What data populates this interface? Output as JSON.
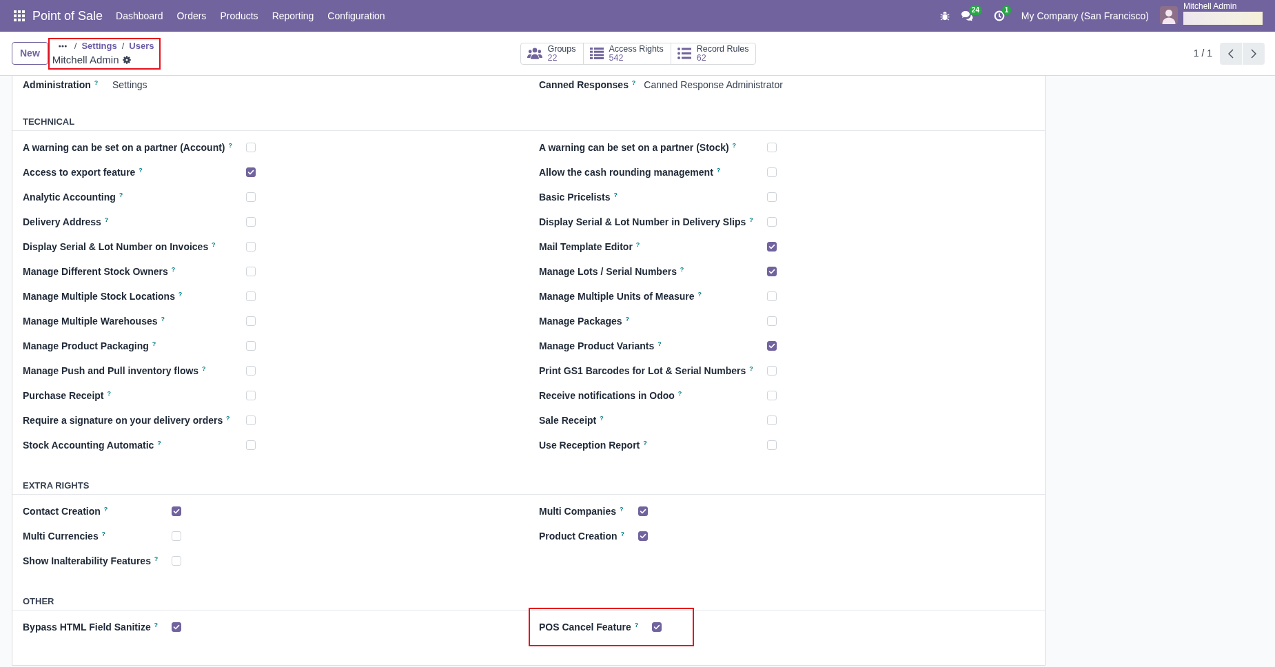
{
  "navbar": {
    "app_name": "Point of Sale",
    "menu": [
      {
        "label": "Dashboard"
      },
      {
        "label": "Orders"
      },
      {
        "label": "Products"
      },
      {
        "label": "Reporting"
      },
      {
        "label": "Configuration"
      }
    ],
    "systray": [
      {
        "kind": "debug"
      },
      {
        "kind": "messages",
        "badge": "24"
      },
      {
        "kind": "activities",
        "badge": "1"
      }
    ],
    "company": "My Company (San Francisco)",
    "user": "Mitchell Admin"
  },
  "control_panel": {
    "new_button": "New",
    "breadcrumb": {
      "links": [
        {
          "separator": "/",
          "label": "Settings"
        },
        {
          "separator": "/",
          "label": "Users"
        }
      ],
      "current": "Mitchell Admin",
      "highlighted": true
    },
    "stat_buttons": [
      {
        "kind": "groups",
        "label": "Groups",
        "value": "22"
      },
      {
        "kind": "access_rights",
        "label": "Access Rights",
        "value": "542"
      },
      {
        "kind": "record_rules",
        "label": "Record Rules",
        "value": "62"
      }
    ],
    "pager": "1 / 1"
  },
  "form": {
    "top_row": [
      {
        "label": "Administration $^{?}$",
        "value": "Settings"
      },
      {
        "label": "Canned Responses $^{?}$",
        "value": "Canned Response Administrator"
      }
    ],
    "sections": [
      {
        "title": "TECHNICAL",
        "left": [
          {
            "label": "A warning can be set on a partner (Account) $^{?}$",
            "checked": false,
            "highlighted": false
          },
          {
            "label": "Access to export feature $^{?}$",
            "checked": true,
            "highlighted": false
          },
          {
            "label": "Analytic Accounting $^{?}$",
            "checked": false,
            "highlighted": false
          },
          {
            "label": "Delivery Address $^{?}$",
            "checked": false,
            "highlighted": false
          },
          {
            "label": "Display Serial & Lot Number on Invoices $^{?}$",
            "checked": false,
            "highlighted": false
          },
          {
            "label": "Manage Different Stock Owners $^{?}$",
            "checked": false,
            "highlighted": false
          },
          {
            "label": "Manage Multiple Stock Locations $^{?}$",
            "checked": false,
            "highlighted": false
          },
          {
            "label": "Manage Multiple Warehouses $^{?}$",
            "checked": false,
            "highlighted": false
          },
          {
            "label": "Manage Product Packaging $^{?}$",
            "checked": false,
            "highlighted": false
          },
          {
            "label": "Manage Push and Pull inventory flows $^{?}$",
            "checked": false,
            "highlighted": false
          },
          {
            "label": "Purchase Receipt $^{?}$",
            "checked": false,
            "highlighted": false
          },
          {
            "label": "Require a signature on your delivery orders $^{?}$",
            "checked": false,
            "highlighted": false
          },
          {
            "label": "Stock Accounting Automatic $^{?}$",
            "checked": false,
            "highlighted": false
          }
        ],
        "right": [
          {
            "label": "A warning can be set on a partner (Stock) $^{?}$",
            "checked": false,
            "highlighted": false
          },
          {
            "label": "Allow the cash rounding management $^{?}$",
            "checked": false,
            "highlighted": false
          },
          {
            "label": "Basic Pricelists $^{?}$",
            "checked": false,
            "highlighted": false
          },
          {
            "label": "Display Serial & Lot Number in Delivery Slips $^{?}$",
            "checked": false,
            "highlighted": false
          },
          {
            "label": "Mail Template Editor $^{?}$",
            "checked": true,
            "highlighted": false
          },
          {
            "label": "Manage Lots / Serial Numbers $^{?}$",
            "checked": true,
            "highlighted": false
          },
          {
            "label": "Manage Multiple Units of Measure $^{?}$",
            "checked": false,
            "highlighted": false
          },
          {
            "label": "Manage Packages $^{?}$",
            "checked": false,
            "highlighted": false
          },
          {
            "label": "Manage Product Variants $^{?}$",
            "checked": true,
            "highlighted": false
          },
          {
            "label": "Print GS1 Barcodes for Lot & Serial Numbers $^{?}$",
            "checked": false,
            "highlighted": false
          },
          {
            "label": "Receive notifications in Odoo $^{?}$",
            "checked": false,
            "highlighted": false
          },
          {
            "label": "Sale Receipt $^{?}$",
            "checked": false,
            "highlighted": false
          },
          {
            "label": "Use Reception Report $^{?}$",
            "checked": false,
            "highlighted": false
          }
        ]
      },
      {
        "title": "EXTRA RIGHTS",
        "left": [
          {
            "label": "Contact Creation $^{?}$",
            "checked": true,
            "highlighted": false
          },
          {
            "label": "Multi Currencies $^{?}$",
            "checked": false,
            "highlighted": false
          },
          {
            "label": "Show Inalterability Features $^{?}$",
            "checked": false,
            "highlighted": false
          }
        ],
        "right": [
          {
            "label": "Multi Companies $^{?}$",
            "checked": true,
            "highlighted": false
          },
          {
            "label": "Product Creation $^{?}$",
            "checked": true,
            "highlighted": false
          }
        ]
      },
      {
        "title": "OTHER",
        "left": [
          {
            "label": "Bypass HTML Field Sanitize $^{?}$",
            "checked": true,
            "highlighted": false
          }
        ],
        "right": [
          {
            "label": "POS Cancel Feature $^{?}$",
            "checked": true,
            "highlighted": true
          }
        ]
      }
    ]
  }
}
